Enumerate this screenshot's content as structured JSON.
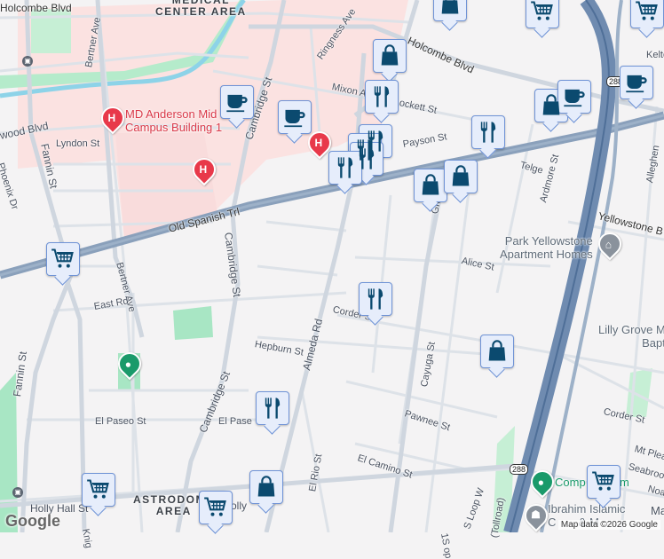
{
  "areas": {
    "medical_center": "MEDICAL\nCENTER AREA",
    "astrodome": "ASTRODOME\nAREA"
  },
  "streets": {
    "holcombe_w": "Holcombe Blvd",
    "holcombe_e": "Holcombe Blvd",
    "bertner_n": "Bertner Ave",
    "bertner_s": "Bertner Ave",
    "brentwood": "wood Blvd",
    "lyndon": "Lyndon St",
    "phoenix": "Phoenix Dr",
    "fannin_n": "Fannin St",
    "fannin_s": "Fannin St",
    "cambridge_n": "Cambridge St",
    "cambridge_s": "Cambridge St",
    "cambridge_s2": "Cambridge St",
    "ringness": "Ringness Ave",
    "mixon": "Mixon A",
    "brockett": "ockett St",
    "payson": "Payson St",
    "telge": "Telge",
    "ardmore": "Ardmore St",
    "grand": "Grand",
    "old_spanish": "Old Spanish Trl",
    "yellowstone": "Yellowstone B",
    "alice": "Alice St",
    "east_rd": "East Rd",
    "corder_w": "Corder St",
    "corder_e": "Corder St",
    "hepburn": "Hepburn St",
    "almeda": "Almeda Rd",
    "cayuga": "Cayuga St",
    "pawnee": "Pawnee St",
    "el_paseo_w": "El Paseo St",
    "el_paseo_e": "El Pase",
    "el_camino": "El Camino St",
    "el_rio": "El Rio St",
    "holly_hall": "Holly Hall St",
    "holly_e": "olly",
    "s_loop": "S Loop W",
    "tollroad": "(Tollroad)",
    "kelton": "Kelto",
    "allegheny": "Alleghen",
    "mt_pleasant": "Mt Plea",
    "seabrook": "Seabroo",
    "noa": "Noa",
    "ma": "Ma",
    "knight": "Knig",
    "ob": "1S op"
  },
  "highway_shield": "288",
  "pois": {
    "md_anderson": "MD Anderson Mid\nCampus Building 1",
    "park_yellowstone": "Park Yellowstone\nApartment Homes",
    "lilly_grove": "Lilly Grove M\nBapt",
    "company_gym": "Comp      Gym",
    "ibrahim": "Ibrahim Islamic\nC       & M"
  },
  "markers": [
    "shopping-bag",
    "shopping-cart",
    "shopping-cart",
    "shopping-bag",
    "restaurant",
    "coffee",
    "coffee",
    "restaurant",
    "restaurant",
    "restaurant",
    "restaurant",
    "restaurant",
    "shopping-bag",
    "shopping-bag",
    "shopping-bag",
    "coffee",
    "coffee",
    "shopping-cart",
    "restaurant",
    "shopping-bag",
    "restaurant",
    "shopping-cart",
    "shopping-bag",
    "shopping-cart",
    "shopping-cart"
  ],
  "attribution": "Map data ©2026 Google",
  "logo": "Google",
  "colors": {
    "road": "#d6dce4",
    "highway": "#7f97b5",
    "medical": "#fbe2e1",
    "park": "#a8e6c4",
    "water": "#8dd3e8",
    "marker_icon": "#0b4a6f"
  }
}
